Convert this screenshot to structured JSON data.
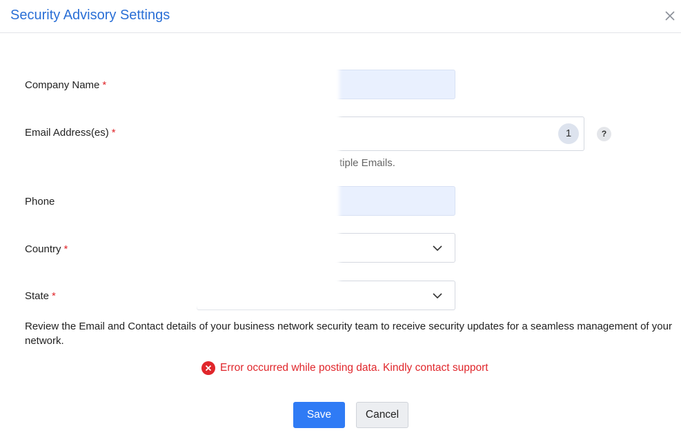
{
  "dialog": {
    "title": "Security Advisory Settings",
    "close_icon": "close-icon"
  },
  "form": {
    "company_name": {
      "label": "Company Name",
      "required": "*"
    },
    "email": {
      "label": "Email Address(es)",
      "required": "*",
      "count": "1",
      "hint": "tiple Emails.",
      "help": "?"
    },
    "phone": {
      "label": "Phone"
    },
    "country": {
      "label": "Country",
      "required": "*"
    },
    "state": {
      "label": "State",
      "required": "*"
    }
  },
  "description": "Review the Email and Contact details of your business network security team to receive security updates for a seamless management of your network.",
  "error": {
    "message": "Error occurred while posting data. Kindly contact support",
    "icon": "error-icon"
  },
  "actions": {
    "save": "Save",
    "cancel": "Cancel"
  },
  "colors": {
    "accent": "#2f7bf5",
    "title": "#2a6fd6",
    "error": "#e0262b",
    "filled_input": "#e9f0fe"
  }
}
